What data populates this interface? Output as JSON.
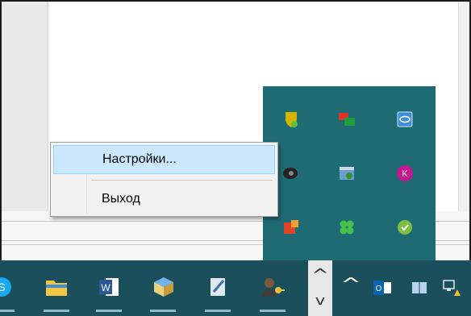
{
  "context_menu": {
    "items": [
      {
        "label": "Настройки...",
        "highlighted": true
      },
      {
        "label": "Выход",
        "highlighted": false
      }
    ]
  },
  "tray_flyout": {
    "icons": [
      "shield-icon",
      "network-icon",
      "intel-graphics-icon",
      "speaker-icon",
      "update-icon",
      "kaspersky-icon",
      "office-icon",
      "clover-icon",
      "skype-check-icon"
    ]
  },
  "taskbar": {
    "pinned": [
      "skype-icon",
      "file-explorer-icon",
      "word-icon",
      "installer-icon",
      "notepad-icon",
      "user-key-icon"
    ],
    "chevron_up": "^",
    "chevron_down": "v",
    "tray_chevron": "^",
    "tray_icons": [
      "outlook-icon",
      "book-icon",
      "network-warning-icon"
    ]
  },
  "colors": {
    "taskbar": "#1b4f5c",
    "flyout": "#1f6b73",
    "menu_highlight": "#cce8ff"
  }
}
